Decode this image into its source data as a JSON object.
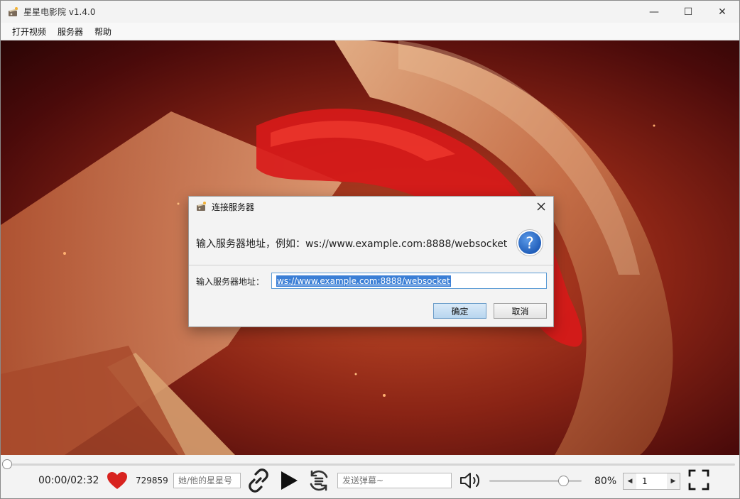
{
  "window": {
    "title": "星星电影院 v1.4.0",
    "minimize": "—",
    "maximize": "☐",
    "close": "✕"
  },
  "menu": {
    "items": [
      {
        "label": "打开视频"
      },
      {
        "label": "服务器"
      },
      {
        "label": "帮助"
      }
    ]
  },
  "controls": {
    "time": "00:00/02:32",
    "likes": "729859",
    "star_placeholder": "她/他的星星号",
    "danmu_placeholder": "发送弹幕~",
    "volume": "80%",
    "volume_fraction": 0.8,
    "page_value": "1",
    "spin_left": "◀",
    "spin_right": "▶",
    "heart_color": "#d8231f"
  },
  "dialog": {
    "title": "连接服务器",
    "message": "输入服务器地址，例如：ws://www.example.com:8888/websocket",
    "field_label": "输入服务器地址：",
    "field_value": "ws://www.example.com:8888/websocket",
    "ok_label": "确定",
    "cancel_label": "取消",
    "question_glyph": "?"
  }
}
